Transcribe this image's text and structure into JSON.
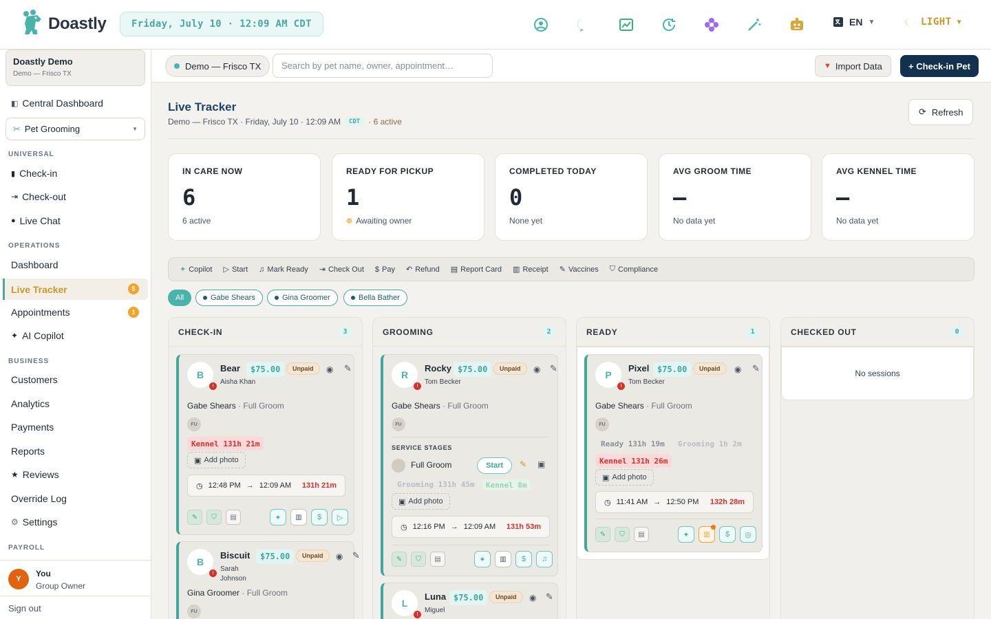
{
  "topbar": {
    "brand": "Doastly",
    "datetime": "Friday, July 10 · 12:09 AM CDT",
    "icons": [
      "user-circle-icon",
      "chat-icon",
      "chart-line-icon",
      "clock-refresh-icon",
      "flower-icon",
      "magic-wand-icon",
      "robot-icon"
    ],
    "language": "EN",
    "theme": "LIGHT",
    "colors": {
      "accent": "#4ab4ab",
      "brand_text": "#2b3440",
      "theme_gold": "#c79a2a",
      "primary_button": "#14304f",
      "danger": "#d9302c",
      "warning": "#f0a52b"
    }
  },
  "sidebar": {
    "account": {
      "name": "Doastly Demo",
      "location": "Demo — Frisco TX"
    },
    "central_dashboard": "Central Dashboard",
    "module_select": "Pet Grooming",
    "sections": {
      "universal": "UNIVERSAL",
      "operations": "OPERATIONS",
      "business": "BUSINESS",
      "payroll": "PAYROLL"
    },
    "universal_items": [
      "Check-in",
      "Check-out",
      "Live Chat"
    ],
    "operations_items": {
      "dashboard": "Dashboard",
      "live_tracker": "Live Tracker",
      "live_tracker_badge": "5",
      "appointments": "Appointments",
      "appointments_badge": "1",
      "ai_copilot": "AI Copilot"
    },
    "business_items": [
      "Customers",
      "Analytics",
      "Payments",
      "Reports",
      "Reviews",
      "Override Log",
      "Settings"
    ],
    "user": {
      "initial": "Y",
      "name": "You",
      "role": "Group Owner"
    },
    "sign_out": "Sign out"
  },
  "subbar": {
    "location": "Demo — Frisco TX",
    "search_placeholder": "Search by pet name, owner, appointment…",
    "import_label": "Import Data",
    "checkin_label": "+ Check-in Pet"
  },
  "main": {
    "title": "Live Tracker",
    "subtitle": "Demo — Frisco TX · Friday, July 10 · 12:09 AM",
    "timezone": "CDT",
    "active": "· 6 active",
    "refresh": "Refresh",
    "kpis": [
      {
        "label": "IN CARE NOW",
        "value": "6",
        "sub": "6 active"
      },
      {
        "label": "READY FOR PICKUP",
        "value": "1",
        "sub": "Awaiting owner"
      },
      {
        "label": "COMPLETED TODAY",
        "value": "0",
        "sub": "None yet"
      },
      {
        "label": "AVG GROOM TIME",
        "value": "—",
        "sub": "No data yet"
      },
      {
        "label": "AVG KENNEL TIME",
        "value": "—",
        "sub": "No data yet"
      }
    ],
    "actions": [
      "Copilot",
      "Start",
      "Mark Ready",
      "Check Out",
      "Pay",
      "Refund",
      "Report Card",
      "Receipt",
      "Vaccines",
      "Compliance"
    ],
    "filters": [
      "All",
      "Gabe Shears",
      "Gina Groomer",
      "Bella Bather"
    ],
    "columns": [
      {
        "title": "CHECK-IN",
        "count": "3"
      },
      {
        "title": "GROOMING",
        "count": "2"
      },
      {
        "title": "READY",
        "count": "1"
      },
      {
        "title": "CHECKED OUT",
        "count": "0",
        "empty": "No sessions"
      }
    ],
    "cards": {
      "bear": {
        "initial": "B",
        "name": "Bear",
        "price": "$75.00",
        "status": "Unpaid",
        "owner": "Aisha Khan",
        "groomer": "Gabe Shears",
        "service": "· Full Groom",
        "staff": "FU",
        "kennel": "Kennel 131h 21m",
        "add_photo": "Add photo",
        "start": "12:48 PM",
        "end": "12:09 AM",
        "duration": "131h 21m"
      },
      "biscuit": {
        "initial": "B",
        "name": "Biscuit",
        "price": "$75.00",
        "status": "Unpaid",
        "owner": "Sarah Johnson",
        "groomer": "Gina Groomer",
        "service": "· Full Groom",
        "staff": "FU"
      },
      "rocky": {
        "initial": "R",
        "name": "Rocky",
        "price": "$75.00",
        "status": "Unpaid",
        "owner": "Tom Becker",
        "groomer": "Gabe Shears",
        "service": "· Full Groom",
        "staff": "FU",
        "stages_label": "SERVICE STAGES",
        "stage": "Full Groom",
        "stage_action": "Start",
        "grooming": "Grooming 131h 45m",
        "kennel": "Kennel 8m",
        "add_photo": "Add photo",
        "start": "12:16 PM",
        "end": "12:09 AM",
        "duration": "131h 53m"
      },
      "luna": {
        "initial": "L",
        "name": "Luna",
        "price": "$75.00",
        "status": "Unpaid",
        "owner": "Miguel"
      },
      "pixel": {
        "initial": "P",
        "name": "Pixel",
        "price": "$75.00",
        "status": "Unpaid",
        "owner": "Tom Becker",
        "groomer": "Gabe Shears",
        "service": "· Full Groom",
        "staff": "FU",
        "ready": "Ready 131h 19m",
        "grooming": "Grooming 1h 2m",
        "kennel": "Kennel 131h 26m",
        "add_photo": "Add photo",
        "start": "11:41 AM",
        "end": "12:50 PM",
        "duration": "132h 28m"
      }
    }
  }
}
